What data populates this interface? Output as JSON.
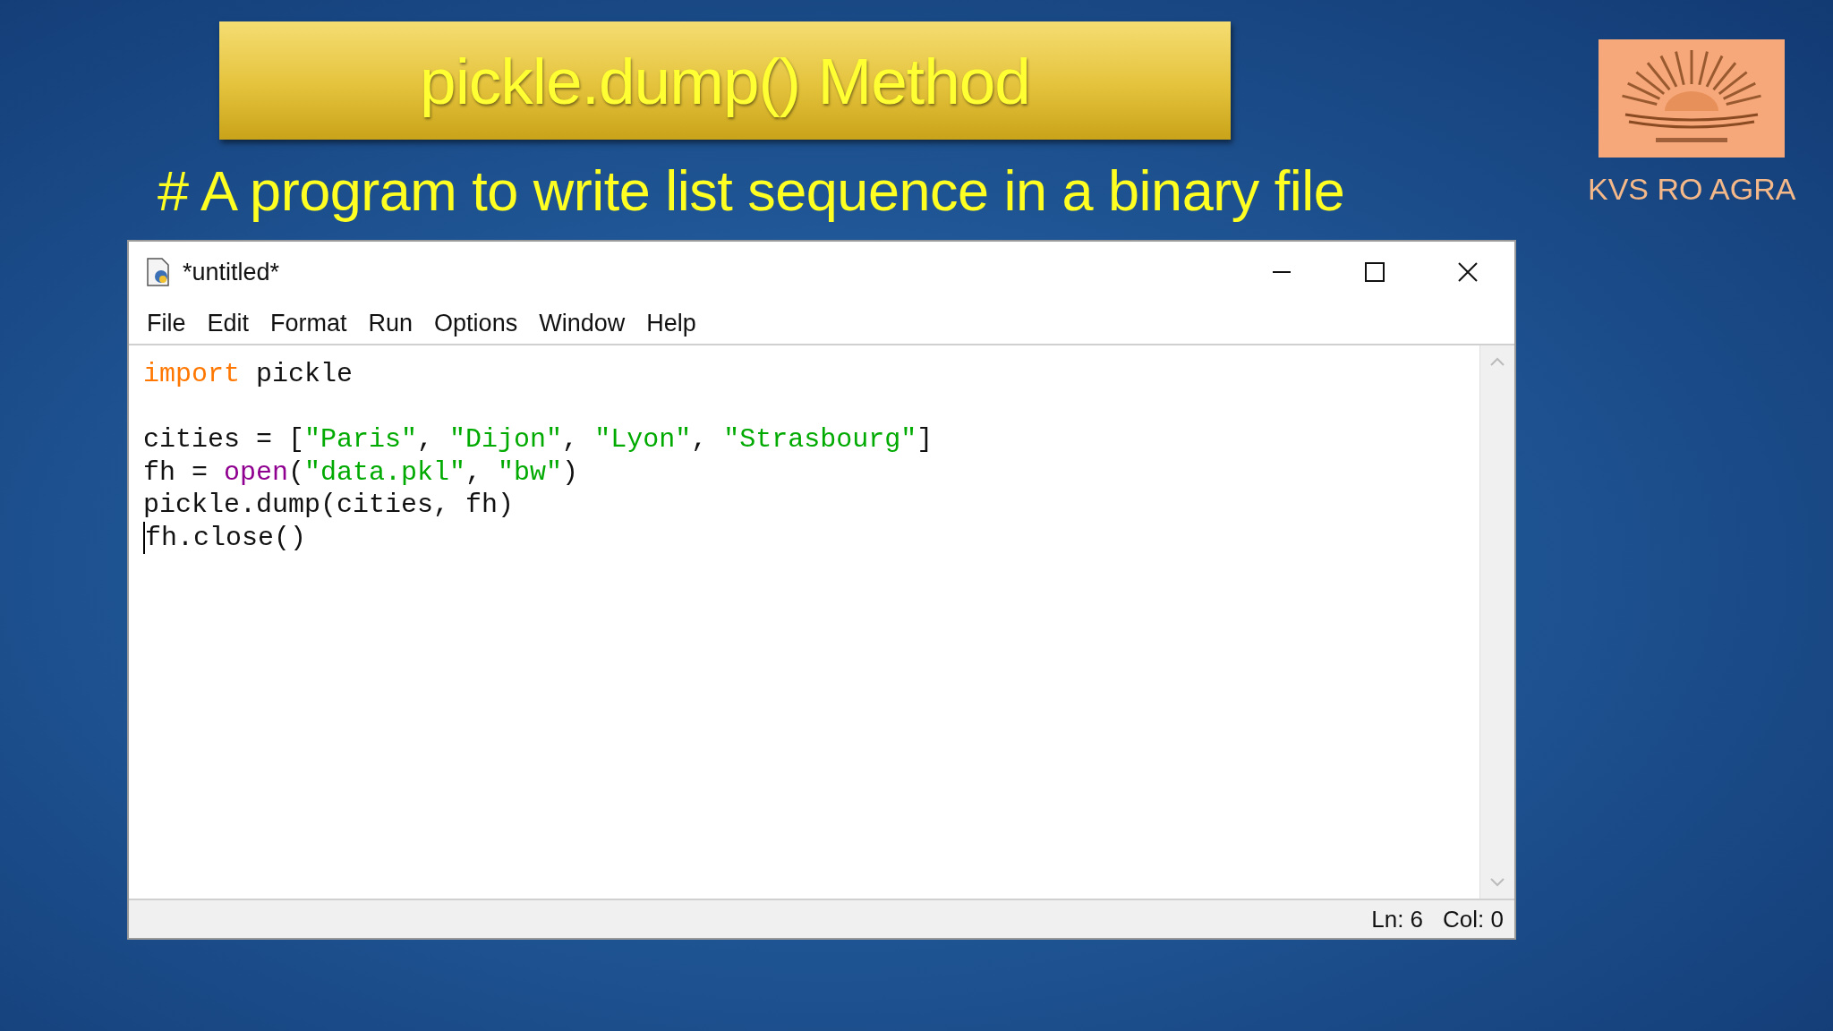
{
  "slide": {
    "title": "pickle.dump() Method",
    "heading": "# A program to write list sequence in a binary file",
    "org": "KVS RO AGRA"
  },
  "window": {
    "title": "*untitled*",
    "menu": [
      "File",
      "Edit",
      "Format",
      "Run",
      "Options",
      "Window",
      "Help"
    ],
    "code": [
      {
        "kind": "code",
        "cursor": false,
        "tokens": [
          {
            "kind": "keyword",
            "text": "import"
          },
          {
            "kind": "plain",
            "text": " pickle"
          }
        ]
      },
      {
        "kind": "blank"
      },
      {
        "kind": "code",
        "cursor": false,
        "tokens": [
          {
            "kind": "plain",
            "text": "cities = ["
          },
          {
            "kind": "string",
            "text": "\"Paris\""
          },
          {
            "kind": "plain",
            "text": ", "
          },
          {
            "kind": "string",
            "text": "\"Dijon\""
          },
          {
            "kind": "plain",
            "text": ", "
          },
          {
            "kind": "string",
            "text": "\"Lyon\""
          },
          {
            "kind": "plain",
            "text": ", "
          },
          {
            "kind": "string",
            "text": "\"Strasbourg\""
          },
          {
            "kind": "plain",
            "text": "]"
          }
        ]
      },
      {
        "kind": "code",
        "cursor": false,
        "tokens": [
          {
            "kind": "plain",
            "text": "fh = "
          },
          {
            "kind": "builtin",
            "text": "open"
          },
          {
            "kind": "plain",
            "text": "("
          },
          {
            "kind": "string",
            "text": "\"data.pkl\""
          },
          {
            "kind": "plain",
            "text": ", "
          },
          {
            "kind": "string",
            "text": "\"bw\""
          },
          {
            "kind": "plain",
            "text": ")"
          }
        ]
      },
      {
        "kind": "code",
        "cursor": false,
        "tokens": [
          {
            "kind": "plain",
            "text": "pickle.dump(cities, fh)"
          }
        ]
      },
      {
        "kind": "code",
        "cursor": true,
        "tokens": [
          {
            "kind": "plain",
            "text": "fh.close()"
          }
        ]
      }
    ],
    "status": {
      "line": "Ln: 6",
      "col": "Col: 0"
    }
  }
}
